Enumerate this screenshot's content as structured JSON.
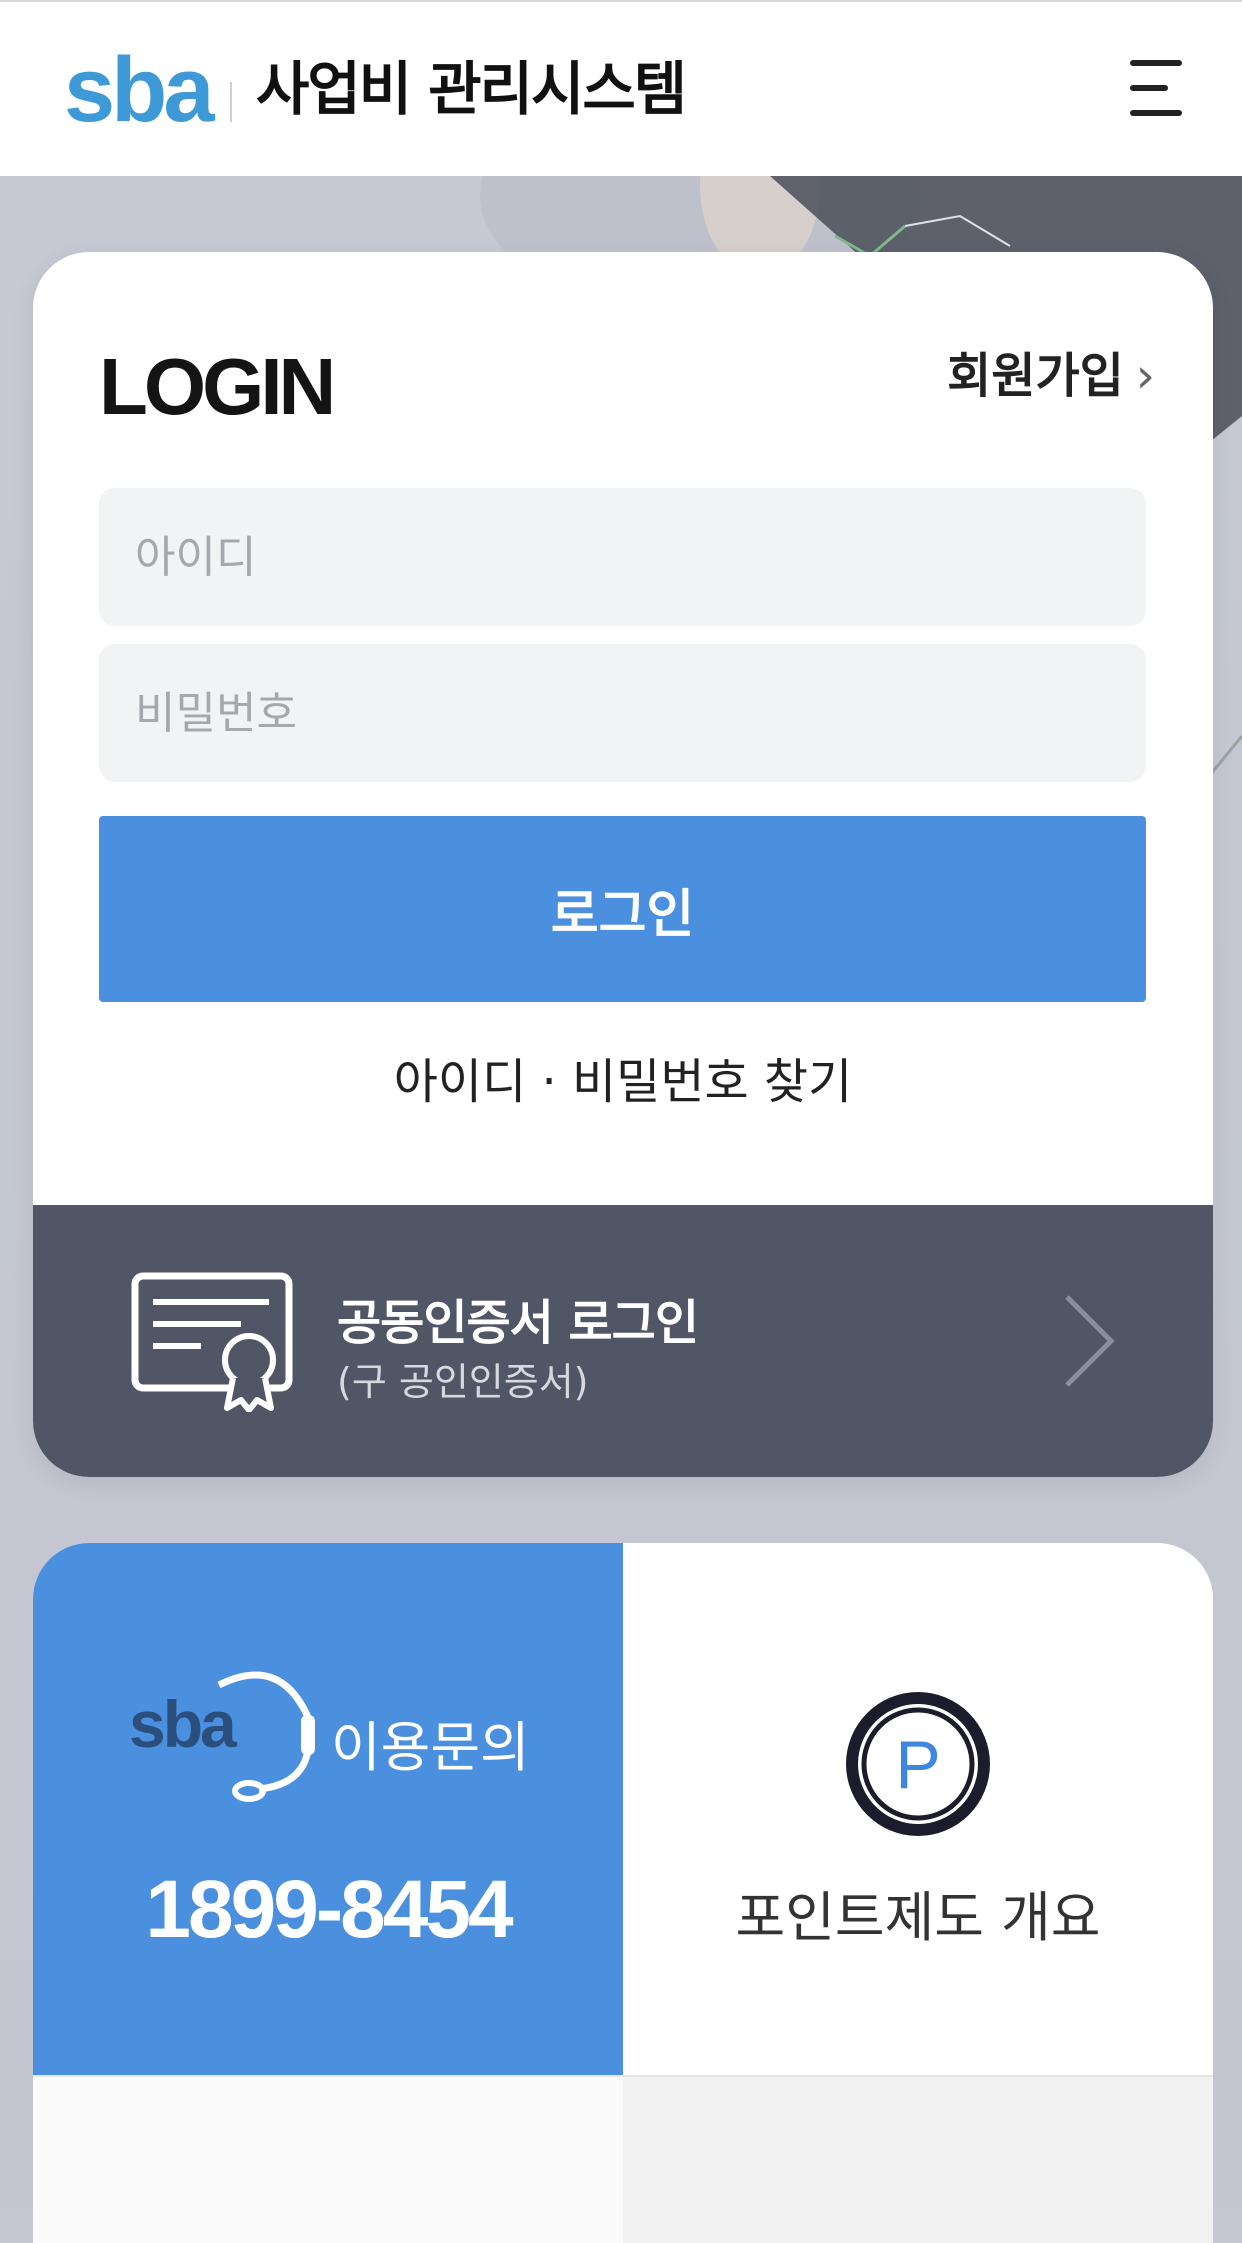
{
  "header": {
    "logo": "sba",
    "title": "사업비 관리시스템",
    "menu_icon": "hamburger-menu-icon"
  },
  "login": {
    "heading": "LOGIN",
    "signup_label": "회원가입",
    "id_placeholder": "아이디",
    "password_placeholder": "비밀번호",
    "submit_label": "로그인",
    "find_label": "아이디 · 비밀번호 찾기"
  },
  "certificate": {
    "title": "공동인증서 로그인",
    "subtitle": "(구 공인인증서)",
    "icon": "certificate-icon"
  },
  "contact": {
    "label": "이용문의",
    "phone": "1899-8454",
    "icon_logo": "sba",
    "icon": "headset-icon"
  },
  "point": {
    "label": "포인트제도 개요",
    "icon_letter": "P",
    "icon": "point-icon"
  },
  "colors": {
    "accent": "#4a90df",
    "logo": "#3d9ad6",
    "cert_bar": "#515666"
  }
}
